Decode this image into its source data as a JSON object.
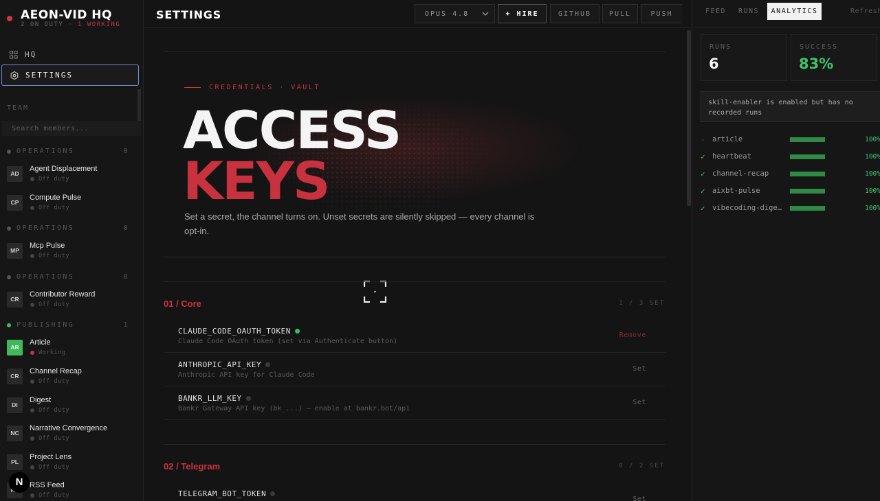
{
  "app": {
    "title": "AEON-VID HQ",
    "on_duty": "2 ON DUTY",
    "separator": "·",
    "working": "1 WORKING"
  },
  "nav": {
    "hq": "HQ",
    "settings": "SETTINGS"
  },
  "team": {
    "header": "TEAM",
    "search_placeholder": "Search members...",
    "groups": [
      {
        "name": "OPERATIONS",
        "count": "0",
        "members": [
          {
            "initials": "AD",
            "name": "Agent Displacement",
            "status": "Off duty"
          },
          {
            "initials": "CP",
            "name": "Compute Pulse",
            "status": "Off duty"
          }
        ]
      },
      {
        "name": "OPERATIONS",
        "count": "0",
        "members": [
          {
            "initials": "MP",
            "name": "Mcp Pulse",
            "status": "Off duty"
          }
        ]
      },
      {
        "name": "OPERATIONS",
        "count": "0",
        "members": [
          {
            "initials": "CR",
            "name": "Contributor Reward",
            "status": "Off duty"
          }
        ]
      },
      {
        "name": "PUBLISHING",
        "count": "1",
        "members": [
          {
            "initials": "AR",
            "name": "Article",
            "status": "Working"
          },
          {
            "initials": "CR",
            "name": "Channel Recap",
            "status": "Off duty"
          },
          {
            "initials": "DI",
            "name": "Digest",
            "status": "Off duty"
          },
          {
            "initials": "NC",
            "name": "Narrative Convergence",
            "status": "Off duty"
          },
          {
            "initials": "PL",
            "name": "Project Lens",
            "status": "Off duty"
          },
          {
            "initials": "RS",
            "name": "RSS Feed",
            "status": "Off duty"
          }
        ]
      }
    ]
  },
  "badge": {
    "letter": "N"
  },
  "topbar": {
    "page_title": "SETTINGS",
    "model": "OPUS 4.8",
    "hire": "+ HIRE",
    "github": "GITHUB",
    "pull": "PULL",
    "push": "PUSH"
  },
  "hero": {
    "eyebrow": "CREDENTIALS · VAULT",
    "line1": "ACCESS",
    "line2": "KEYS",
    "description": "Set a secret, the channel turns on. Unset secrets are silently skipped — every channel is opt-in."
  },
  "sections": [
    {
      "title": "01 / Core",
      "count": "1 / 3 SET",
      "keys": [
        {
          "name": "CLAUDE_CODE_OAUTH_TOKEN",
          "desc": "Claude Code OAuth token (set via Authenticate button)",
          "action": "Remove",
          "is_set": true
        },
        {
          "name": "ANTHROPIC_API_KEY",
          "desc": "Anthropic API key for Claude Code",
          "action": "Set",
          "is_set": false
        },
        {
          "name": "BANKR_LLM_KEY",
          "desc": "Bankr Gateway API key (bk_...) — enable at bankr.bot/api",
          "action": "Set",
          "is_set": false
        }
      ]
    },
    {
      "title": "02 / Telegram",
      "count": "0 / 2 SET",
      "keys": [
        {
          "name": "TELEGRAM_BOT_TOKEN",
          "desc": "",
          "action": "Set",
          "is_set": false
        }
      ]
    }
  ],
  "right": {
    "tabs": {
      "feed": "FEED",
      "runs": "RUNS",
      "analytics": "ANALYTICS",
      "refresh": "Refresh"
    },
    "stats": {
      "runs_label": "RUNS",
      "runs_value": "6",
      "success_label": "SUCCESS",
      "success_value": "83%"
    },
    "notice": "skill-enabler is enabled but has no recorded runs",
    "skills": [
      {
        "check": "-",
        "name": "article",
        "pct": "100%",
        "rate": 1.0
      },
      {
        "check": "✓",
        "name": "heartbeat",
        "pct": "100%",
        "rate": 1.0
      },
      {
        "check": "✓",
        "name": "channel-recap",
        "pct": "100%",
        "rate": 1.0
      },
      {
        "check": "✓",
        "name": "aixbt-pulse",
        "pct": "100%",
        "rate": 1.0
      },
      {
        "check": "✓",
        "name": "vibecoding-dige…",
        "pct": "100%",
        "rate": 1.0
      }
    ]
  },
  "colors": {
    "accent_red": "#c8323f",
    "accent_green": "#3fc46a",
    "focus_blue": "#6f8fd8"
  }
}
